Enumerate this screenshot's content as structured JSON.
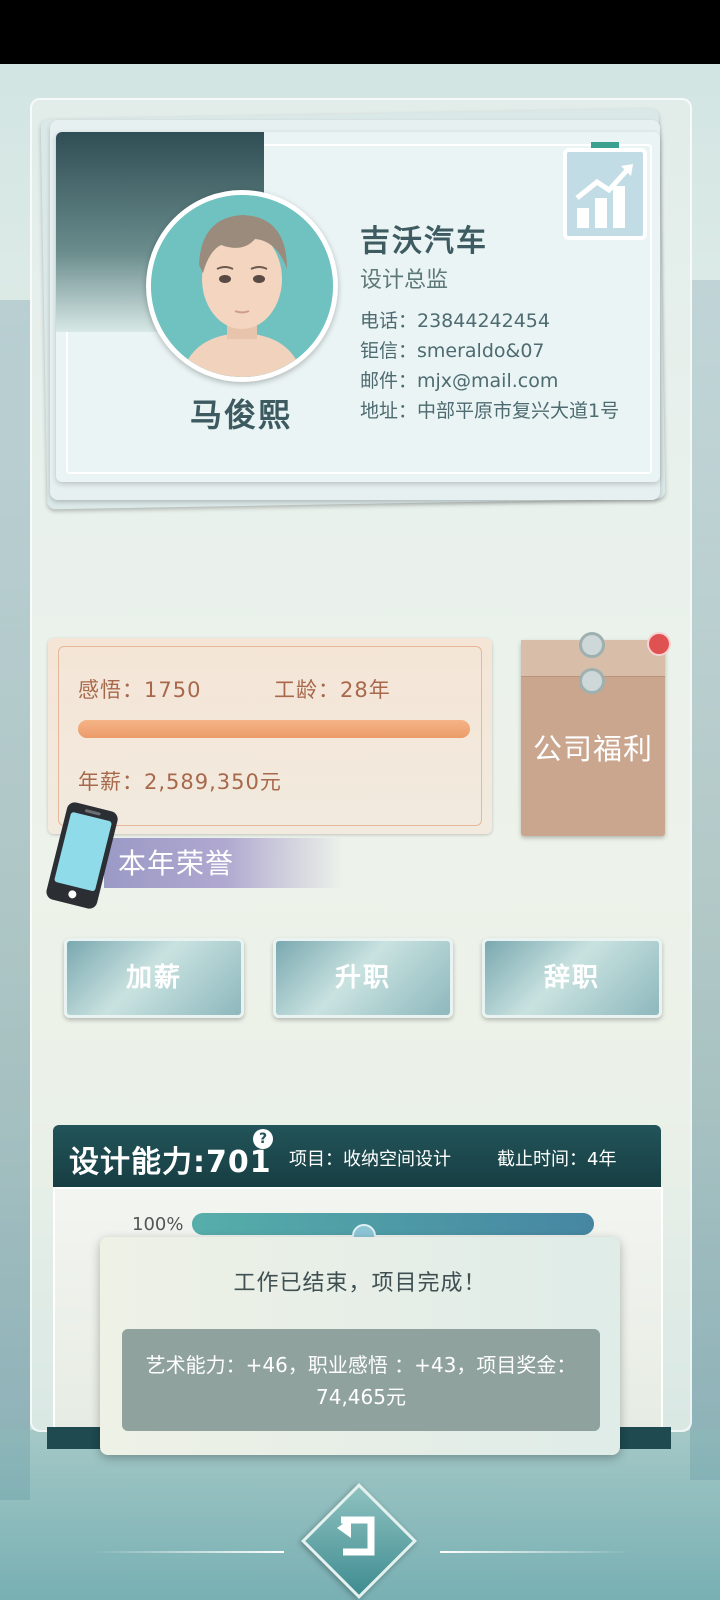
{
  "card": {
    "name": "马俊熙",
    "company": "吉沃汽车",
    "position": "设计总监",
    "phone": "电话：23844242454",
    "chat": "钜信：smeraldo&07",
    "email": "邮件：mjx@mail.com",
    "address": "地址：中部平原市复兴大道1号"
  },
  "stats": {
    "insight": "感悟：1750",
    "seniority": "工龄：28年",
    "salary": "年薪：2,589,350元",
    "bar_fraction": 1.0
  },
  "welfare": {
    "label": "公司福利"
  },
  "honor": {
    "label": "本年荣誉"
  },
  "actions": {
    "raise": "加薪",
    "promote": "升职",
    "resign": "辞职"
  },
  "project": {
    "skill": "设计能力:701",
    "help": "?",
    "name": "项目：收纳空间设计",
    "deadline": "截止时间：4年",
    "progress_label": "100%",
    "progress_fraction": 1.0
  },
  "popup": {
    "title": "工作已结束，项目完成！",
    "reward": "艺术能力：+46，职业感悟 ：+43，项目奖金：74,465元"
  },
  "colors": {
    "header_dark": "#1a4348",
    "salary_text": "#a7684b",
    "card_text": "#3d5b60"
  }
}
